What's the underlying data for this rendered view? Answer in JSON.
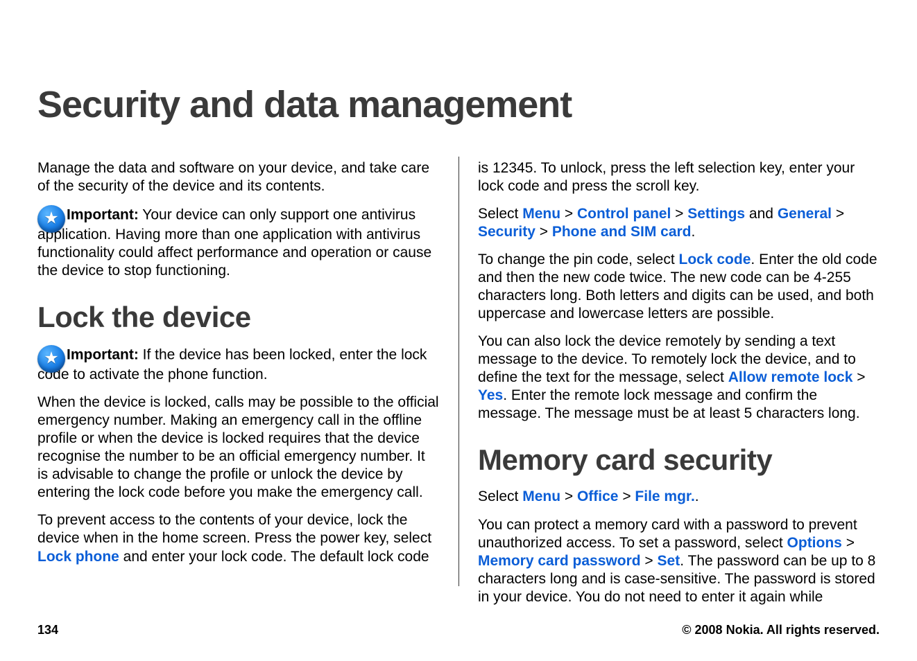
{
  "title": "Security and data management",
  "left": {
    "intro": "Manage the data and software on your device, and take care of the security of the device and its contents.",
    "imp1_label": "Important:",
    "imp1_text": " Your device can only support one antivirus application. Having more than one application with antivirus functionality could affect performance and operation or cause the device to stop functioning.",
    "h2_lock": "Lock the device",
    "imp2_label": "Important:",
    "imp2_text": " If the device has been locked, enter the lock code to activate the phone function.",
    "p_emerg": "When the device is locked, calls may be possible to the official emergency number. Making an emergency call in the offline profile or when the device is locked requires that the device recognise the number to be an official emergency number. It is advisable to change the profile or unlock the device by entering the lock code before you make the emergency call.",
    "p_prevent_a": "To prevent access to the contents of your device, lock the device when in the home screen. Press the power key, select ",
    "lock_phone": "Lock phone",
    "p_prevent_b": " and enter your lock code. The default lock code"
  },
  "right": {
    "p_is12345": "is 12345. To unlock, press the left selection key, enter your lock code and press the scroll key.",
    "select1_pre": "Select ",
    "menu": "Menu",
    "gt": " > ",
    "control_panel": "Control panel",
    "settings": "Settings",
    "and": " and ",
    "general": "General",
    "security": "Security",
    "phone_sim": "Phone and SIM card",
    "period": ".",
    "p_pin_a": "To change the pin code, select ",
    "lock_code": "Lock code",
    "p_pin_b": ". Enter the old code and then the new code twice. The new code can be 4-255 characters long. Both letters and digits can be used, and both uppercase and lowercase letters are possible.",
    "p_remote_a": "You can also lock the device remotely by sending a text message to the device. To remotely lock the device, and to define the text for the message, select ",
    "allow_remote": "Allow remote lock",
    "yes": "Yes",
    "p_remote_b": ". Enter the remote lock message and confirm the message. The message must be at least 5 characters long.",
    "h2_memory": "Memory card security",
    "select2_pre": "Select ",
    "office": "Office",
    "file_mgr": "File mgr.",
    "p_mem_a": "You can protect a memory card with a password to prevent unauthorized access. To set a password, select ",
    "options": "Options",
    "mem_card_pw": "Memory card password",
    "set": "Set",
    "p_mem_b": ". The password can be up to 8 characters long and is case-sensitive. The password is stored in your device. You do not need to enter it again while"
  },
  "footer": {
    "page": "134",
    "copyright": "© 2008 Nokia. All rights reserved."
  }
}
